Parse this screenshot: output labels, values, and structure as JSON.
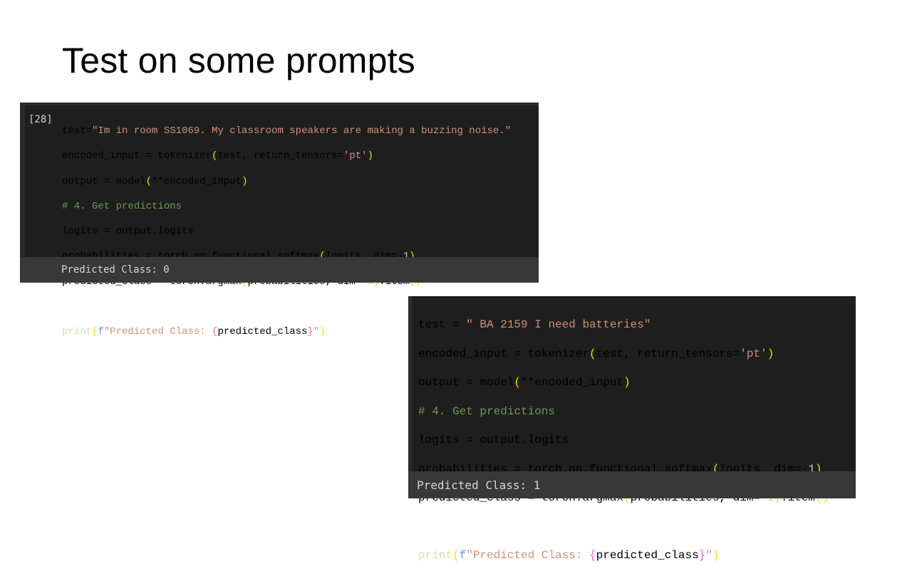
{
  "slide": {
    "title": "Test on some prompts"
  },
  "cell1": {
    "execution_count": "[28]",
    "lines": {
      "l1_a": "test=",
      "l1_s": "\"Im in room SS1069. My classroom speakers are making a buzzing noise.\"",
      "l2_a": "encoded_input = tokenizer",
      "l2_b": "(",
      "l2_c": "test, return_tensors=",
      "l2_s": "'pt'",
      "l2_d": ")",
      "l3_a": "output = model",
      "l3_b": "(",
      "l3_c": "**encoded_input",
      "l3_d": ")",
      "l4_c": "# 4. Get predictions",
      "l5_a": "logits = output.logits",
      "l6_a": "probabilities = torch.nn.functional.softmax",
      "l6_b": "(",
      "l6_c": "logits, dim=-",
      "l6_n": "1",
      "l6_d": ")",
      "l7_a": "predicted_class = torch.argmax",
      "l7_b": "(",
      "l7_c": "probabilities, dim=-",
      "l7_n": "1",
      "l7_d": ")",
      "l7_e": ".item",
      "l7_f": "()",
      "l9_fn": "print",
      "l9_b": "(",
      "l9_f": "f",
      "l9_s1": "\"Predicted Class: ",
      "l9_o": "{",
      "l9_v": "predicted_class",
      "l9_cl": "}",
      "l9_s2": "\"",
      "l9_d": ")"
    },
    "output": "Predicted Class: 0"
  },
  "cell2": {
    "lines": {
      "l1_a": "test = ",
      "l1_s": "\" BA 2159 I need batteries\"",
      "l2_a": "encoded_input = tokenizer",
      "l2_b": "(",
      "l2_c": "test, return_tensors=",
      "l2_s": "'pt'",
      "l2_d": ")",
      "l3_a": "output = model",
      "l3_b": "(",
      "l3_c": "**encoded_input",
      "l3_d": ")",
      "l4_c": "# 4. Get predictions",
      "l5_a": "logits = output.logits",
      "l6_a": "probabilities = torch.nn.functional.softmax",
      "l6_b": "(",
      "l6_c": "logits, dim=-",
      "l6_n": "1",
      "l6_d": ")",
      "l7_a": "predicted_class = torch.argmax",
      "l7_b": "(",
      "l7_c": "probabilities, dim=-",
      "l7_n": "1",
      "l7_d": ")",
      "l7_e": ".item",
      "l7_f": "()",
      "l9_fn": "print",
      "l9_b": "(",
      "l9_f": "f",
      "l9_s1": "\"Predicted Class: ",
      "l9_o": "{",
      "l9_v": "predicted_class",
      "l9_cl": "}",
      "l9_s2": "\"",
      "l9_d": ")"
    },
    "output": "Predicted Class: 1"
  },
  "colors": {
    "editor_bg": "#1e1e1e",
    "output_bg": "#383838",
    "string": "#ce9178",
    "comment": "#6a9955",
    "bracket": "#ffd700",
    "bracket_inner": "#da70d6",
    "number": "#b5cea8"
  }
}
